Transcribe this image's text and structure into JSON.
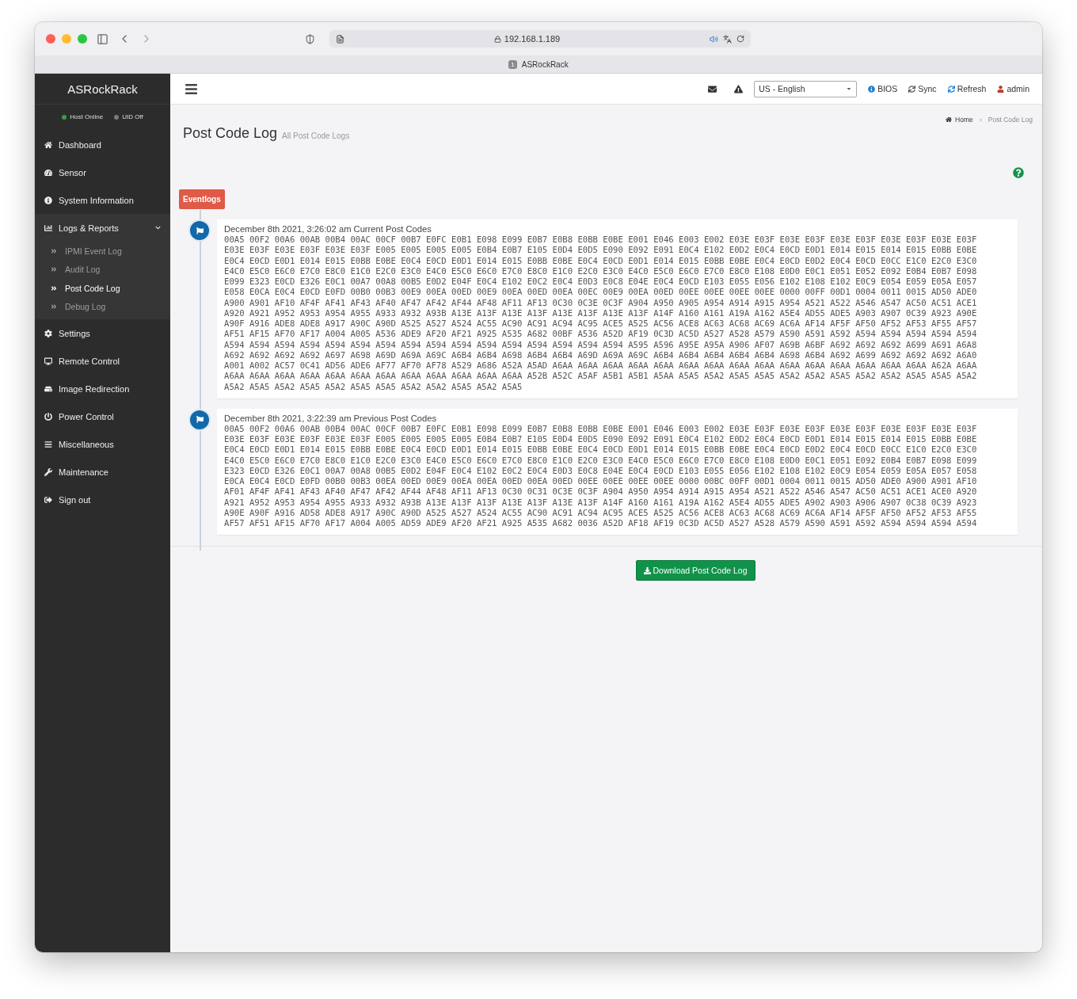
{
  "browser": {
    "address": "192.168.1.189",
    "tab_badge": "1",
    "tab_title": "ASRockRack"
  },
  "sidebar": {
    "brand": "ASRockRack",
    "status": [
      {
        "label": "Host Online",
        "color": "#3a9d46"
      },
      {
        "label": "UID Off",
        "color": "#7a7a7a"
      }
    ],
    "items": [
      {
        "label": "Dashboard"
      },
      {
        "label": "Sensor"
      },
      {
        "label": "System Information"
      },
      {
        "label": "Logs & Reports",
        "expanded": true,
        "children": [
          {
            "label": "IPMI Event Log",
            "selected": false
          },
          {
            "label": "Audit Log",
            "selected": false
          },
          {
            "label": "Post Code Log",
            "selected": true
          },
          {
            "label": "Debug Log",
            "selected": false
          }
        ]
      },
      {
        "label": "Settings"
      },
      {
        "label": "Remote Control"
      },
      {
        "label": "Image Redirection"
      },
      {
        "label": "Power Control"
      },
      {
        "label": "Miscellaneous"
      },
      {
        "label": "Maintenance"
      },
      {
        "label": "Sign out"
      }
    ]
  },
  "header": {
    "language": "US - English",
    "actions": [
      "BIOS",
      "Sync",
      "Refresh",
      "admin"
    ]
  },
  "page": {
    "title": "Post Code Log",
    "subtitle": "All Post Code Logs",
    "breadcrumb": [
      "Home",
      "Post Code Log"
    ],
    "timeline_label": "Eventlogs",
    "entries": [
      {
        "heading": "December 8th 2021, 3:26:02 am Current Post Codes",
        "rows": [
          "00A5 00F2 00A6 00AB 00B4 00AC 00CF 00B7 E0FC E0B1 E098 E099 E0B7 E0B8 E0BB E0BE E001 E046 E003 E002 E03E E03F E03E E03F E03E E03F E03E E03F E03E E03F",
          "E03E E03F E03E E03F E03E E03F E005 E005 E005 E005 E0B4 E0B7 E105 E0D4 E0D5 E090 E092 E091 E0C4 E102 E0D2 E0C4 E0CD E0D1 E014 E015 E014 E015 E0BB E0BE",
          "E0C4 E0CD E0D1 E014 E015 E0BB E0BE E0C4 E0CD E0D1 E014 E015 E0BB E0BE E0C4 E0CD E0D1 E014 E015 E0BB E0BE E0C4 E0CD E0D2 E0C4 E0CD E0CC E1C0 E2C0 E3C0",
          "E4C0 E5C0 E6C0 E7C0 E8C0 E1C0 E2C0 E3C0 E4C0 E5C0 E6C0 E7C0 E8C0 E1C0 E2C0 E3C0 E4C0 E5C0 E6C0 E7C0 E8C0 E108 E0D0 E0C1 E051 E052 E092 E0B4 E0B7 E098",
          "E099 E323 E0CD E326 E0C1 00A7 00A8 00B5 E0D2 E04F E0C4 E102 E0C2 E0C4 E0D3 E0C8 E04E E0C4 E0CD E103 E055 E056 E102 E108 E102 E0C9 E054 E059 E05A E057",
          "E058 E0CA E0C4 E0CD E0FD 00B0 00B3 00E9 00EA 00ED 00E9 00EA 00ED 00EA 00EC 00E9 00EA 00ED 00EE 00EE 00EE 00EE 0000 00FF 00D1 0004 0011 0015 AD50 ADE0",
          "A900 A901 AF10 AF4F AF41 AF43 AF40 AF47 AF42 AF44 AF48 AF11 AF13 0C30 0C3E 0C3F A904 A950 A905 A954 A914 A915 A954 A521 A522 A546 A547 AC50 AC51 ACE1",
          "A920 A921 A952 A953 A954 A955 A933 A932 A93B A13E A13F A13E A13F A13E A13F A13E A13F A14F A160 A161 A19A A162 A5E4 AD55 ADE5 A903 A907 0C39 A923 A90E",
          "A90F A916 ADE8 ADE8 A917 A90C A90D A525 A527 A524 AC55 AC90 AC91 AC94 AC95 ACE5 A525 AC56 ACE8 AC63 AC68 AC69 AC6A AF14 AF5F AF50 AF52 AF53 AF55 AF57",
          "AF51 AF15 AF70 AF17 A004 A005 A536 ADE9 AF20 AF21 A925 A535 A682 00BF A536 A52D AF19 0C3D AC5D A527 A528 A579 A590 A591 A592 A594 A594 A594 A594 A594",
          "A594 A594 A594 A594 A594 A594 A594 A594 A594 A594 A594 A594 A594 A594 A594 A594 A595 A596 A95E A95A A906 AF07 A69B A6BF A692 A692 A692 A699 A691 A6A8",
          "A692 A692 A692 A692 A697 A698 A69D A69A A69C A6B4 A6B4 A698 A6B4 A6B4 A69D A69A A69C A6B4 A6B4 A6B4 A6B4 A6B4 A698 A6B4 A692 A699 A692 A692 A692 A6A0",
          "A001 A002 AC57 0C41 AD56 ADE6 AF77 AF70 AF78 A529 A686 A52A A5AD A6AA A6AA A6AA A6AA A6AA A6AA A6AA A6AA A6AA A6AA A6AA A6AA A6AA A6AA A6AA A62A A6AA",
          "A6AA A6AA A6AA A6AA A6AA A6AA A6AA A6AA A6AA A6AA A6AA A6AA A52B A52C A5AF A5B1 A5B1 A5AA A5A5 A5A2 A5A5 A5A5 A5A2 A5A2 A5A5 A5A2 A5A2 A5A5 A5A5 A5A2",
          "A5A2 A5A5 A5A2 A5A5 A5A2 A5A5 A5A5 A5A2 A5A2 A5A5 A5A2 A5A5"
        ]
      },
      {
        "heading": "December 8th 2021, 3:22:39 am Previous Post Codes",
        "rows": [
          "00A5 00F2 00A6 00AB 00B4 00AC 00CF 00B7 E0FC E0B1 E098 E099 E0B7 E0B8 E0BB E0BE E001 E046 E003 E002 E03E E03F E03E E03F E03E E03F E03E E03F E03E E03F",
          "E03E E03F E03E E03F E03E E03F E005 E005 E005 E005 E0B4 E0B7 E105 E0D4 E0D5 E090 E092 E091 E0C4 E102 E0D2 E0C4 E0CD E0D1 E014 E015 E014 E015 E0BB E0BE",
          "E0C4 E0CD E0D1 E014 E015 E0BB E0BE E0C4 E0CD E0D1 E014 E015 E0BB E0BE E0C4 E0CD E0D1 E014 E015 E0BB E0BE E0C4 E0CD E0D2 E0C4 E0CD E0CC E1C0 E2C0 E3C0",
          "E4C0 E5C0 E6C0 E7C0 E8C0 E1C0 E2C0 E3C0 E4C0 E5C0 E6C0 E7C0 E8C0 E1C0 E2C0 E3C0 E4C0 E5C0 E6C0 E7C0 E8C0 E108 E0D0 E0C1 E051 E092 E0B4 E0B7 E098 E099",
          "E323 E0CD E326 E0C1 00A7 00A8 00B5 E0D2 E04F E0C4 E102 E0C2 E0C4 E0D3 E0C8 E04E E0C4 E0CD E103 E055 E056 E102 E108 E102 E0C9 E054 E059 E05A E057 E058",
          "E0CA E0C4 E0CD E0FD 00B0 00B3 00EA 00ED 00E9 00EA 00EA 00ED 00EA 00ED 00EE 00EE 00EE 00EE 0000 00BC 00FF 00D1 0004 0011 0015 AD50 ADE0 A900 A901 AF10",
          "AF01 AF4F AF41 AF43 AF40 AF47 AF42 AF44 AF48 AF11 AF13 0C30 0C31 0C3E 0C3F A904 A950 A954 A914 A915 A954 A521 A522 A546 A547 AC50 AC51 ACE1 ACE0 A920",
          "A921 A952 A953 A954 A955 A933 A932 A93B A13E A13F A13F A13E A13F A13E A13F A14F A160 A161 A19A A162 A5E4 AD55 ADE5 A902 A903 A906 A907 0C38 0C39 A923",
          "A90E A90F A916 AD58 ADE8 A917 A90C A90D A525 A527 A524 AC55 AC90 AC91 AC94 AC95 ACE5 A525 AC56 ACE8 AC63 AC68 AC69 AC6A AF14 AF5F AF50 AF52 AF53 AF55",
          "AF57 AF51 AF15 AF70 AF17 A004 A005 AD59 ADE9 AF20 AF21 A925 A535 A682 0036 A52D AF18 AF19 0C3D AC5D A527 A528 A579 A590 A591 A592 A594 A594 A594 A594"
        ]
      }
    ],
    "download_button": "Download Post Code Log"
  }
}
